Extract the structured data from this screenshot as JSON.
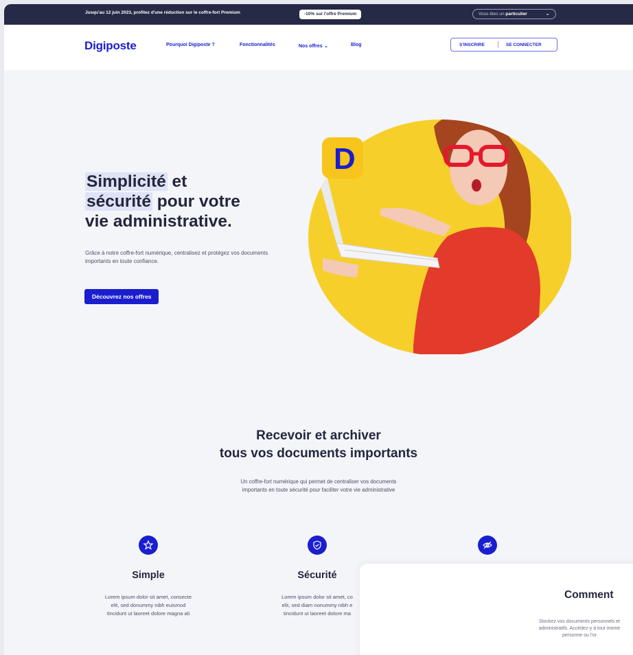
{
  "promo": {
    "text": "Jusqu'au 12 juin 2023, profitez d'une réduction sur le coffre-fort Premium",
    "badge": "-10% sur l'offre Premium",
    "user_type_prefix": "Vous êtes un",
    "user_type_value": "particulier"
  },
  "nav": {
    "logo": "Digiposte",
    "links": [
      "Pourquoi Digiposte ?",
      "Fonctionnalités",
      "Nos offres",
      "Blog"
    ],
    "signup": "S'INSCRIRE",
    "login": "SE CONNECTER"
  },
  "hero": {
    "title_part1": "Simplicité",
    "title_part2": " et",
    "title_part3": "sécurité",
    "title_part4": " pour votre",
    "title_part5": "vie administrative.",
    "description": "Grâce à notre coffre-fort numérique, centralisez et protégez vos documents importants en toute confiance.",
    "cta": "Découvrez nos offres",
    "app_icon_letter": "D"
  },
  "section": {
    "title_line1": "Recevoir et archiver",
    "title_line2": "tous vos documents importants",
    "desc_line1": "Un coffre-fort numérique qui permet de centraliser vos documents",
    "desc_line2": "importants en toute sécurité pour faciliter votre vie administrative"
  },
  "features": [
    {
      "title": "Simple",
      "icon": "star-icon",
      "line1": "Lorem ipsum dolor sit amet, consecte",
      "line2": "elit, sed donummy nibh euismod",
      "line3": "tincidunt ut laoreet dolore magna ali"
    },
    {
      "title": "Sécurité",
      "icon": "shield-check-icon",
      "line1": "Lorem ipsum dolor sit amet, co",
      "line2": "elit, sed diam nonummy nibh e",
      "line3": "tincidunt ut laoreet dolore ma"
    },
    {
      "title": "",
      "icon": "eye-slash-icon",
      "line1": "",
      "line2": "",
      "line3": ""
    }
  ],
  "card": {
    "title": "Comment",
    "line1": "Stockez vos documents personnels et",
    "line2": "administratifs. Accédez-y à tout mome",
    "line3": "personne ou l'or"
  },
  "colors": {
    "brand": "#1a1ecf",
    "promo_bg": "#262a46",
    "hero_circle": "#f7cf2a",
    "dress": "#e23b2c"
  }
}
